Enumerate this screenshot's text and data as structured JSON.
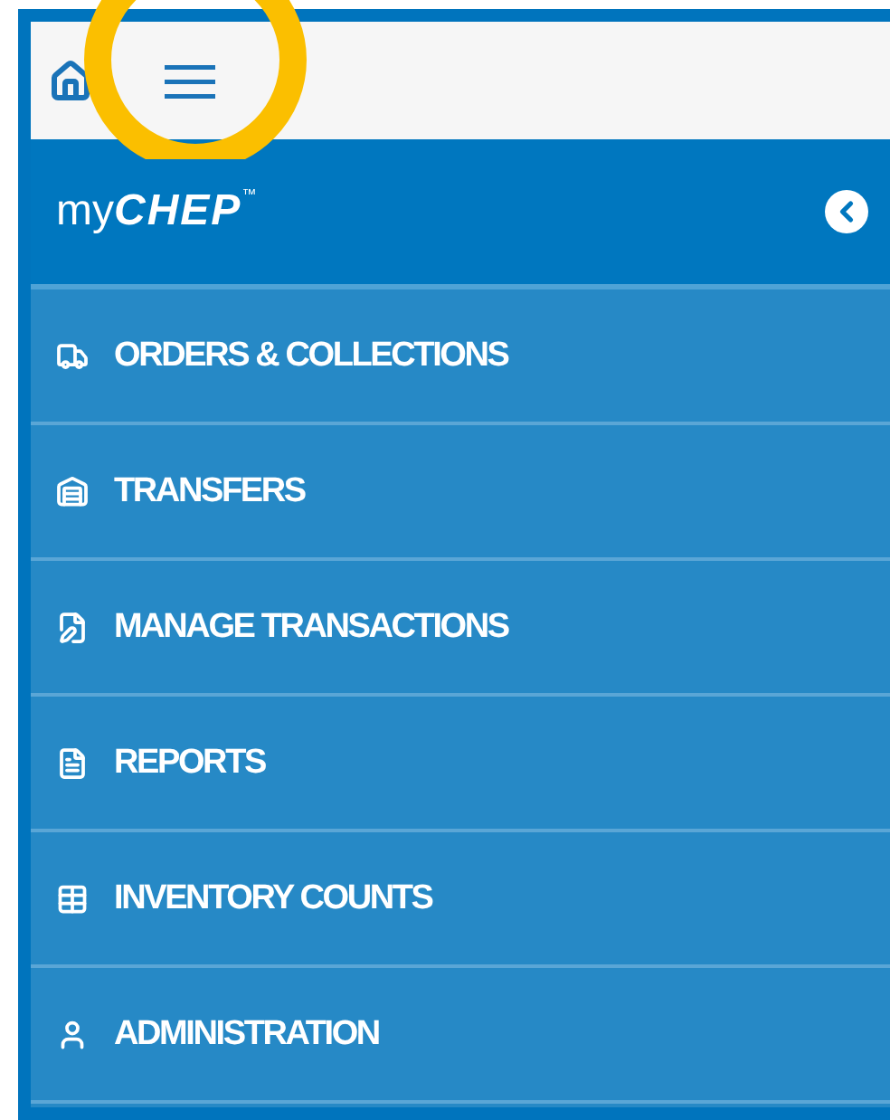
{
  "header": {
    "logo": "my**CHEP**$^{™}$"
  },
  "menu": [
    {
      "label": "ORDERS & COLLECTIONS"
    },
    {
      "label": "TRANSFERS"
    },
    {
      "label": "MANAGE TRANSACTIONS"
    },
    {
      "label": "REPORTS"
    },
    {
      "label": "INVENTORY COUNTS"
    },
    {
      "label": "ADMINISTRATION"
    }
  ]
}
